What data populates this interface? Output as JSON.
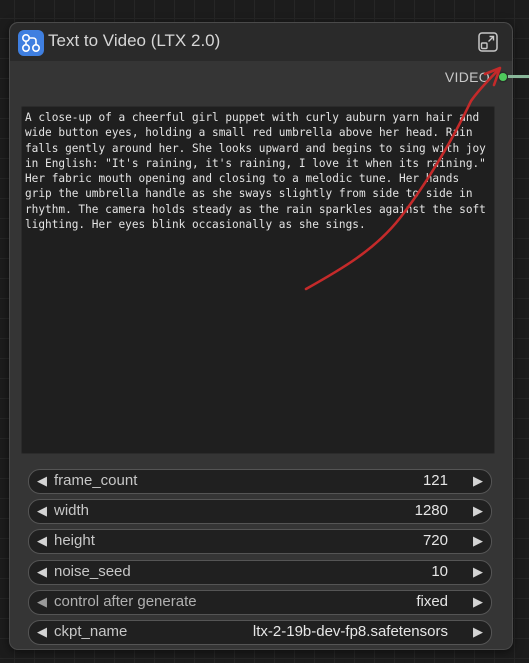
{
  "node": {
    "title": "Text to Video (LTX 2.0)",
    "icon": "node-graph-icon",
    "expand_icon": "expand-icon",
    "output_label": "VIDEO",
    "output_color": "#4ec95c",
    "prompt": "A close-up of a cheerful girl puppet with curly auburn yarn hair and wide button eyes, holding a small red umbrella above her head. Rain falls gently around her. She looks upward and begins to sing with joy in English: \"It's raining, it's raining, I love it when its raining.\" Her fabric mouth opening and closing to a melodic tune. Her hands grip the umbrella handle as she sways slightly from side to side in rhythm. The camera holds steady as the rain sparkles against the soft lighting. Her eyes blink occasionally as she sings."
  },
  "widgets": [
    {
      "label": "frame_count",
      "value": "121"
    },
    {
      "label": "width",
      "value": "1280"
    },
    {
      "label": "height",
      "value": "720"
    },
    {
      "label": "noise_seed",
      "value": "10"
    },
    {
      "label": "control after generate",
      "value": "fixed"
    },
    {
      "label": "ckpt_name",
      "value": "ltx-2-19b-dev-fp8.safetensors"
    }
  ],
  "arrows": {
    "left": "◀",
    "right": "▶"
  },
  "annotation": {
    "color": "#c42a2a",
    "type": "arrow pointing to expand icon"
  }
}
